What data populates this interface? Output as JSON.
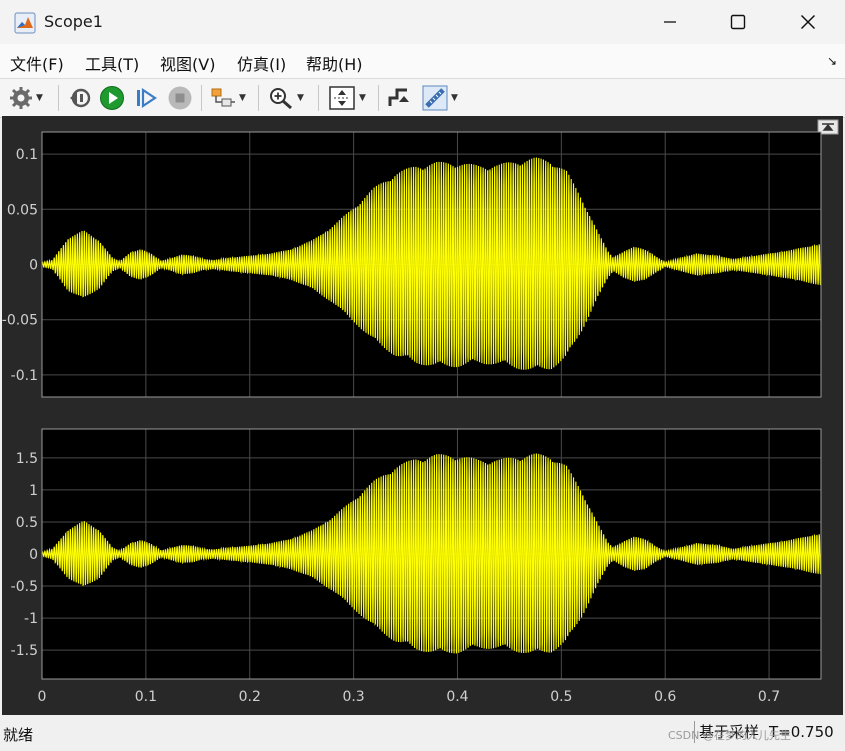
{
  "window": {
    "title": "Scope1"
  },
  "menu": {
    "items": [
      "文件(F)",
      "工具(T)",
      "视图(V)",
      "仿真(I)",
      "帮助(H)"
    ],
    "undock_glyph": "↘"
  },
  "toolbar": {
    "buttons": [
      {
        "name": "settings-gear-icon",
        "dropdown": true
      },
      {
        "name": "step-back-icon",
        "dropdown": false
      },
      {
        "name": "run-icon",
        "dropdown": false
      },
      {
        "name": "step-forward-icon",
        "dropdown": false
      },
      {
        "name": "stop-icon",
        "dropdown": false
      },
      {
        "name": "highlight-block-icon",
        "dropdown": true
      },
      {
        "name": "zoom-in-icon",
        "dropdown": true
      },
      {
        "name": "autoscale-icon",
        "dropdown": true
      },
      {
        "name": "triggers-icon",
        "dropdown": false
      },
      {
        "name": "measurements-icon",
        "dropdown": true
      }
    ]
  },
  "status": {
    "left": "就绪",
    "mode": "基于采样",
    "time": "T=0.750"
  },
  "watermark": "CSDN @在梦的人儿先生",
  "colors": {
    "trace": "#ffff00",
    "axes_bg": "#000000",
    "figure_bg": "#282828",
    "grid": "#4a4a4a",
    "tick_text": "#d0d0d0"
  },
  "chart_data": [
    {
      "type": "line",
      "title": "",
      "xlabel": "",
      "ylabel": "",
      "xlim": [
        0,
        0.75
      ],
      "ylim": [
        -0.12,
        0.12
      ],
      "yticks": [
        -0.1,
        -0.05,
        0,
        0.05,
        0.1
      ],
      "ytick_labels": [
        "-0.1",
        "-0.05",
        "0",
        "0.05",
        "0.1"
      ],
      "xticks": [
        0,
        0.1,
        0.2,
        0.3,
        0.4,
        0.5,
        0.6,
        0.7
      ],
      "xtick_labels": [],
      "grid": true,
      "series": [
        {
          "oscillation_cycles": 160,
          "envelope": [
            [
              0.0,
              0.002
            ],
            [
              0.01,
              0.004
            ],
            [
              0.025,
              0.024
            ],
            [
              0.04,
              0.031
            ],
            [
              0.055,
              0.022
            ],
            [
              0.068,
              0.006
            ],
            [
              0.075,
              0.003
            ],
            [
              0.085,
              0.011
            ],
            [
              0.095,
              0.014
            ],
            [
              0.105,
              0.01
            ],
            [
              0.115,
              0.003
            ],
            [
              0.125,
              0.006
            ],
            [
              0.135,
              0.009
            ],
            [
              0.145,
              0.008
            ],
            [
              0.155,
              0.005
            ],
            [
              0.165,
              0.004
            ],
            [
              0.18,
              0.006
            ],
            [
              0.2,
              0.008
            ],
            [
              0.22,
              0.01
            ],
            [
              0.24,
              0.014
            ],
            [
              0.26,
              0.022
            ],
            [
              0.28,
              0.035
            ],
            [
              0.3,
              0.052
            ],
            [
              0.32,
              0.07
            ],
            [
              0.34,
              0.083
            ],
            [
              0.36,
              0.09
            ],
            [
              0.38,
              0.093
            ],
            [
              0.4,
              0.093
            ],
            [
              0.42,
              0.09
            ],
            [
              0.44,
              0.091
            ],
            [
              0.46,
              0.095
            ],
            [
              0.475,
              0.097
            ],
            [
              0.49,
              0.095
            ],
            [
              0.505,
              0.085
            ],
            [
              0.52,
              0.06
            ],
            [
              0.535,
              0.03
            ],
            [
              0.545,
              0.012
            ],
            [
              0.55,
              0.006
            ],
            [
              0.56,
              0.012
            ],
            [
              0.57,
              0.016
            ],
            [
              0.58,
              0.014
            ],
            [
              0.59,
              0.008
            ],
            [
              0.6,
              0.002
            ],
            [
              0.615,
              0.006
            ],
            [
              0.63,
              0.01
            ],
            [
              0.65,
              0.008
            ],
            [
              0.665,
              0.005
            ],
            [
              0.68,
              0.007
            ],
            [
              0.7,
              0.01
            ],
            [
              0.72,
              0.013
            ],
            [
              0.74,
              0.017
            ],
            [
              0.75,
              0.019
            ]
          ]
        }
      ]
    },
    {
      "type": "line",
      "title": "",
      "xlabel": "",
      "ylabel": "",
      "xlim": [
        0,
        0.75
      ],
      "ylim": [
        -1.95,
        1.95
      ],
      "yticks": [
        -1.5,
        -1,
        -0.5,
        0,
        0.5,
        1,
        1.5
      ],
      "ytick_labels": [
        "-1.5",
        "-1",
        "-0.5",
        "0",
        "0.5",
        "1",
        "1.5"
      ],
      "xticks": [
        0,
        0.1,
        0.2,
        0.3,
        0.4,
        0.5,
        0.6,
        0.7
      ],
      "xtick_labels": [
        "0",
        "0.1",
        "0.2",
        "0.3",
        "0.4",
        "0.5",
        "0.6",
        "0.7"
      ],
      "grid": true,
      "series": [
        {
          "oscillation_cycles": 160,
          "envelope": [
            [
              0.0,
              0.03
            ],
            [
              0.01,
              0.08
            ],
            [
              0.025,
              0.38
            ],
            [
              0.04,
              0.52
            ],
            [
              0.055,
              0.38
            ],
            [
              0.068,
              0.1
            ],
            [
              0.075,
              0.05
            ],
            [
              0.085,
              0.17
            ],
            [
              0.095,
              0.22
            ],
            [
              0.105,
              0.16
            ],
            [
              0.115,
              0.05
            ],
            [
              0.125,
              0.1
            ],
            [
              0.135,
              0.14
            ],
            [
              0.145,
              0.13
            ],
            [
              0.155,
              0.08
            ],
            [
              0.165,
              0.07
            ],
            [
              0.18,
              0.1
            ],
            [
              0.2,
              0.13
            ],
            [
              0.22,
              0.17
            ],
            [
              0.24,
              0.24
            ],
            [
              0.26,
              0.37
            ],
            [
              0.28,
              0.58
            ],
            [
              0.3,
              0.86
            ],
            [
              0.32,
              1.15
            ],
            [
              0.34,
              1.37
            ],
            [
              0.36,
              1.5
            ],
            [
              0.38,
              1.56
            ],
            [
              0.4,
              1.55
            ],
            [
              0.42,
              1.48
            ],
            [
              0.44,
              1.48
            ],
            [
              0.46,
              1.54
            ],
            [
              0.475,
              1.57
            ],
            [
              0.49,
              1.54
            ],
            [
              0.505,
              1.38
            ],
            [
              0.52,
              0.98
            ],
            [
              0.535,
              0.48
            ],
            [
              0.545,
              0.18
            ],
            [
              0.55,
              0.1
            ],
            [
              0.56,
              0.2
            ],
            [
              0.57,
              0.27
            ],
            [
              0.58,
              0.24
            ],
            [
              0.59,
              0.13
            ],
            [
              0.6,
              0.04
            ],
            [
              0.615,
              0.1
            ],
            [
              0.63,
              0.17
            ],
            [
              0.65,
              0.14
            ],
            [
              0.665,
              0.08
            ],
            [
              0.68,
              0.12
            ],
            [
              0.7,
              0.17
            ],
            [
              0.72,
              0.22
            ],
            [
              0.74,
              0.29
            ],
            [
              0.75,
              0.32
            ]
          ]
        }
      ]
    }
  ]
}
